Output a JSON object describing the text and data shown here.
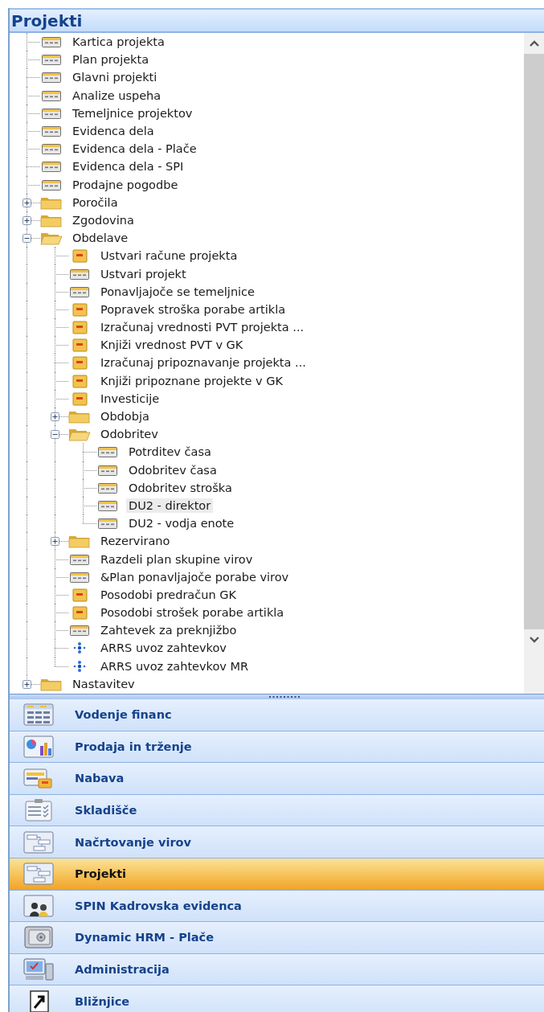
{
  "header": {
    "title": "Projekti"
  },
  "tree": [
    {
      "label": "Kartica projekta",
      "kind": "form",
      "selected": false
    },
    {
      "label": "Plan projekta",
      "kind": "form",
      "selected": false
    },
    {
      "label": "Glavni projekti",
      "kind": "form",
      "selected": false
    },
    {
      "label": "Analize uspeha",
      "kind": "form",
      "selected": false
    },
    {
      "label": "Temeljnice projektov",
      "kind": "form",
      "selected": false
    },
    {
      "label": "Evidenca dela",
      "kind": "form",
      "selected": false
    },
    {
      "label": "Evidenca dela - Plače",
      "kind": "form",
      "selected": false
    },
    {
      "label": "Evidenca dela - SPI",
      "kind": "form",
      "selected": false
    },
    {
      "label": "Prodajne pogodbe",
      "kind": "form",
      "selected": false
    },
    {
      "label": "Poročila",
      "kind": "folder",
      "expanded": false,
      "selected": false
    },
    {
      "label": "Zgodovina",
      "kind": "folder",
      "expanded": false,
      "selected": false
    },
    {
      "label": "Obdelave",
      "kind": "folder",
      "expanded": true,
      "selected": false,
      "children": [
        {
          "label": "Ustvari račune projekta",
          "kind": "report",
          "selected": false
        },
        {
          "label": "Ustvari projekt",
          "kind": "form",
          "selected": false
        },
        {
          "label": "Ponavljajoče se temeljnice",
          "kind": "form",
          "selected": false
        },
        {
          "label": "Popravek stroška porabe artikla",
          "kind": "report",
          "selected": false
        },
        {
          "label": "Izračunaj vrednosti PVT projekta ...",
          "kind": "report",
          "selected": false
        },
        {
          "label": "Knjiži vrednost PVT v GK",
          "kind": "report",
          "selected": false
        },
        {
          "label": "Izračunaj pripoznavanje projekta ...",
          "kind": "report",
          "selected": false
        },
        {
          "label": "Knjiži pripoznane projekte v GK",
          "kind": "report",
          "selected": false
        },
        {
          "label": "Investicije",
          "kind": "report",
          "selected": false
        },
        {
          "label": "Obdobja",
          "kind": "folder",
          "expanded": false,
          "selected": false
        },
        {
          "label": "Odobritev",
          "kind": "folder",
          "expanded": true,
          "selected": false,
          "children": [
            {
              "label": "Potrditev časa",
              "kind": "form",
              "selected": false
            },
            {
              "label": "Odobritev časa",
              "kind": "form",
              "selected": false
            },
            {
              "label": "Odobritev stroška",
              "kind": "form",
              "selected": false
            },
            {
              "label": "DU2 - direktor",
              "kind": "form",
              "selected": true
            },
            {
              "label": "DU2 - vodja enote",
              "kind": "form",
              "selected": false
            }
          ]
        },
        {
          "label": "Rezervirano",
          "kind": "folder",
          "expanded": false,
          "selected": false
        },
        {
          "label": "Razdeli plan skupine virov",
          "kind": "form",
          "selected": false
        },
        {
          "label": "&Plan ponavljajoče porabe virov",
          "kind": "form",
          "selected": false
        },
        {
          "label": "Posodobi predračun GK",
          "kind": "report",
          "selected": false
        },
        {
          "label": "Posodobi strošek porabe artikla",
          "kind": "report",
          "selected": false
        },
        {
          "label": "Zahtevek za preknjižbo",
          "kind": "form",
          "selected": false
        },
        {
          "label": "ARRS uvoz zahtevkov",
          "kind": "dataport",
          "selected": false
        },
        {
          "label": "ARRS uvoz zahtevkov MR",
          "kind": "dataport",
          "selected": false
        }
      ]
    },
    {
      "label": "Nastavitev",
      "kind": "folder",
      "expanded": false,
      "selected": false
    }
  ],
  "modules": [
    {
      "label": "Vodenje financ",
      "kind": "grid",
      "selected": false
    },
    {
      "label": "Prodaja in trženje",
      "kind": "chart",
      "selected": false
    },
    {
      "label": "Nabava",
      "kind": "cards",
      "selected": false
    },
    {
      "label": "Skladišče",
      "kind": "checklist",
      "selected": false
    },
    {
      "label": "Načrtovanje virov",
      "kind": "flowchart",
      "selected": false
    },
    {
      "label": "Projekti",
      "kind": "flowchart",
      "selected": true
    },
    {
      "label": "SPIN Kadrovska evidenca",
      "kind": "people",
      "selected": false
    },
    {
      "label": "Dynamic HRM - Plače",
      "kind": "safe",
      "selected": false
    },
    {
      "label": "Administracija",
      "kind": "computer",
      "selected": false
    },
    {
      "label": "Bližnjice",
      "kind": "shortcut",
      "selected": false
    }
  ]
}
